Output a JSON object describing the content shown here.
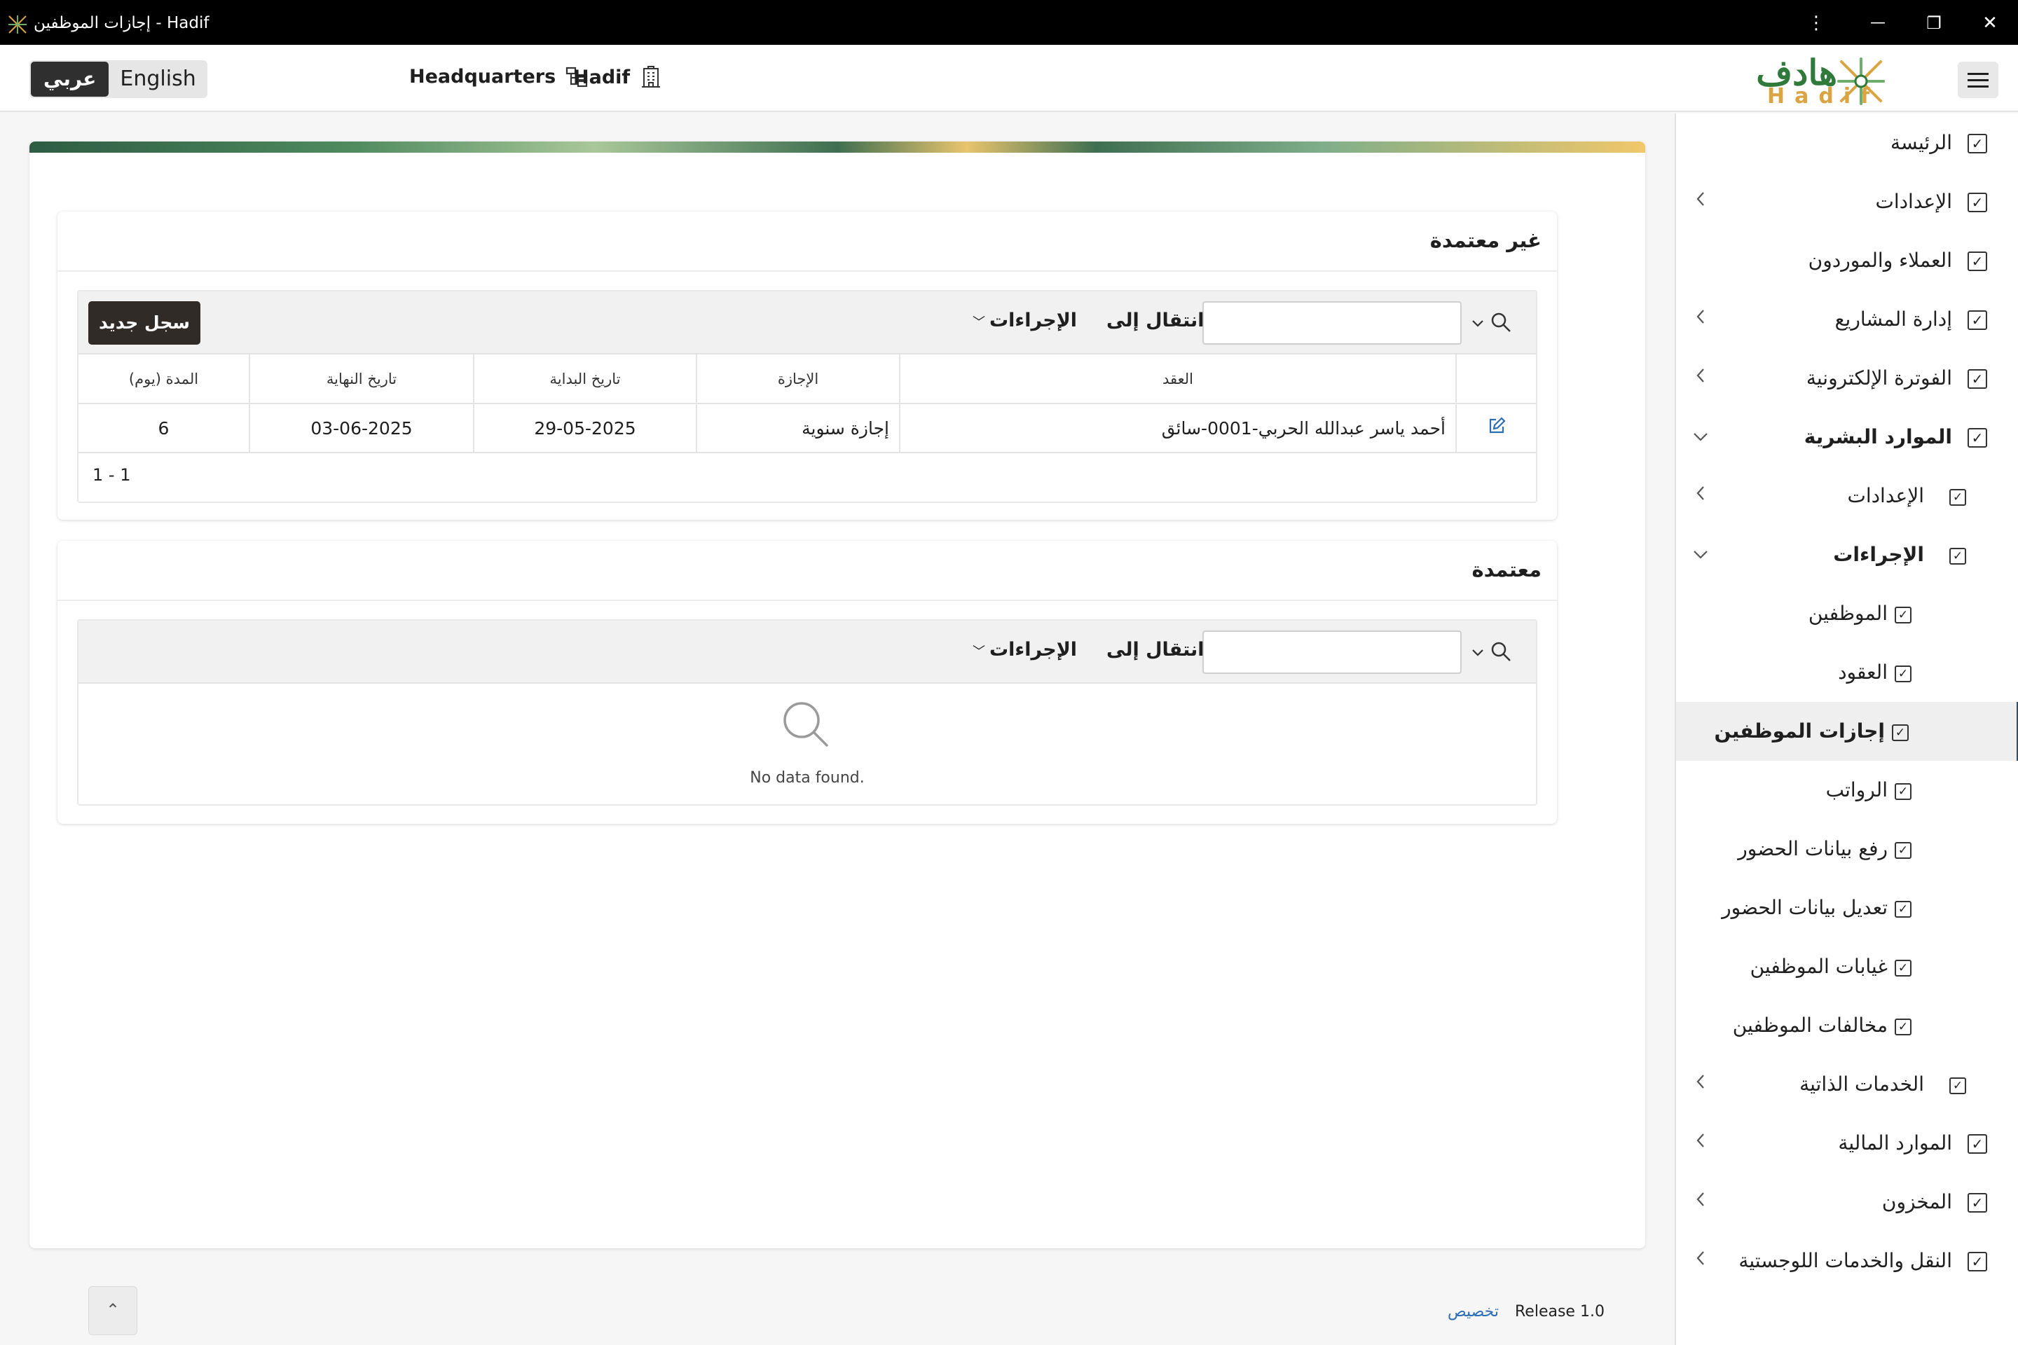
{
  "window": {
    "title": "إجازات الموظفين - Hadif",
    "controls": {
      "more": "⋮",
      "minimize": "—",
      "restore": "❐",
      "close": "✕"
    }
  },
  "header": {
    "lang_arabic": "عربي",
    "lang_english": "English",
    "headquarters": "Headquarters",
    "organization": "Hadif",
    "logo_arabic": "هادف",
    "logo_english": "Hadif"
  },
  "sidebar": {
    "items": [
      {
        "label": "الرئيسة",
        "level": 0,
        "expand": "none",
        "bold": false
      },
      {
        "label": "الإعدادات",
        "level": 0,
        "expand": "collapsed",
        "bold": false
      },
      {
        "label": "العملاء والموردون",
        "level": 0,
        "expand": "none",
        "bold": false
      },
      {
        "label": "إدارة المشاريع",
        "level": 0,
        "expand": "collapsed",
        "bold": false
      },
      {
        "label": "الفوترة الإلكترونية",
        "level": 0,
        "expand": "collapsed",
        "bold": false
      },
      {
        "label": "الموارد البشرية",
        "level": 0,
        "expand": "expanded",
        "bold": true
      },
      {
        "label": "الإعدادات",
        "level": 1,
        "expand": "collapsed",
        "bold": false
      },
      {
        "label": "الإجراءات",
        "level": 1,
        "expand": "expanded",
        "bold": true
      },
      {
        "label": "الموظفين",
        "level": 2,
        "expand": "none",
        "bold": false
      },
      {
        "label": "العقود",
        "level": 2,
        "expand": "none",
        "bold": false
      },
      {
        "label": "إجازات الموظفين",
        "level": 2,
        "expand": "none",
        "bold": true,
        "active": true
      },
      {
        "label": "الرواتب",
        "level": 2,
        "expand": "none",
        "bold": false
      },
      {
        "label": "رفع بيانات الحضور",
        "level": 2,
        "expand": "none",
        "bold": false
      },
      {
        "label": "تعديل بيانات الحضور",
        "level": 2,
        "expand": "none",
        "bold": false
      },
      {
        "label": "غيابات الموظفين",
        "level": 2,
        "expand": "none",
        "bold": false
      },
      {
        "label": "مخالفات الموظفين",
        "level": 2,
        "expand": "none",
        "bold": false
      },
      {
        "label": "الخدمات الذاتية",
        "level": 1,
        "expand": "collapsed",
        "bold": false
      },
      {
        "label": "الموارد المالية",
        "level": 0,
        "expand": "collapsed",
        "bold": false
      },
      {
        "label": "المخزون",
        "level": 0,
        "expand": "collapsed",
        "bold": false
      },
      {
        "label": "النقل والخدمات اللوجستية",
        "level": 0,
        "expand": "collapsed",
        "bold": false
      }
    ]
  },
  "unapproved": {
    "title": "غير معتمدة",
    "search_value": "",
    "goto_label": "انتقال إلى",
    "actions_label": "الإجراءات",
    "create_label": "سجل جديد",
    "columns": [
      "العقد",
      "الإجازة",
      "تاريخ البداية",
      "تاريخ النهاية",
      "المدة (يوم)"
    ],
    "rows": [
      {
        "contract": "أحمد ياسر عبدالله الحربي-0001-سائق",
        "leave": "إجازة سنوية",
        "start_date": "29-05-2025",
        "end_date": "03-06-2025",
        "duration": "6"
      }
    ],
    "pagination": "1 - 1"
  },
  "approved": {
    "title": "معتمدة",
    "search_value": "",
    "goto_label": "انتقال إلى",
    "actions_label": "الإجراءات",
    "no_data": "No data found."
  },
  "footer": {
    "release": "Release 1.0",
    "customize": "تخصيص",
    "to_top": "⌃"
  },
  "colors": {
    "brand_green": "#2f7a3a",
    "brand_gold": "#d9a441",
    "primary_button": "#312b27",
    "link": "#2c6db3"
  }
}
